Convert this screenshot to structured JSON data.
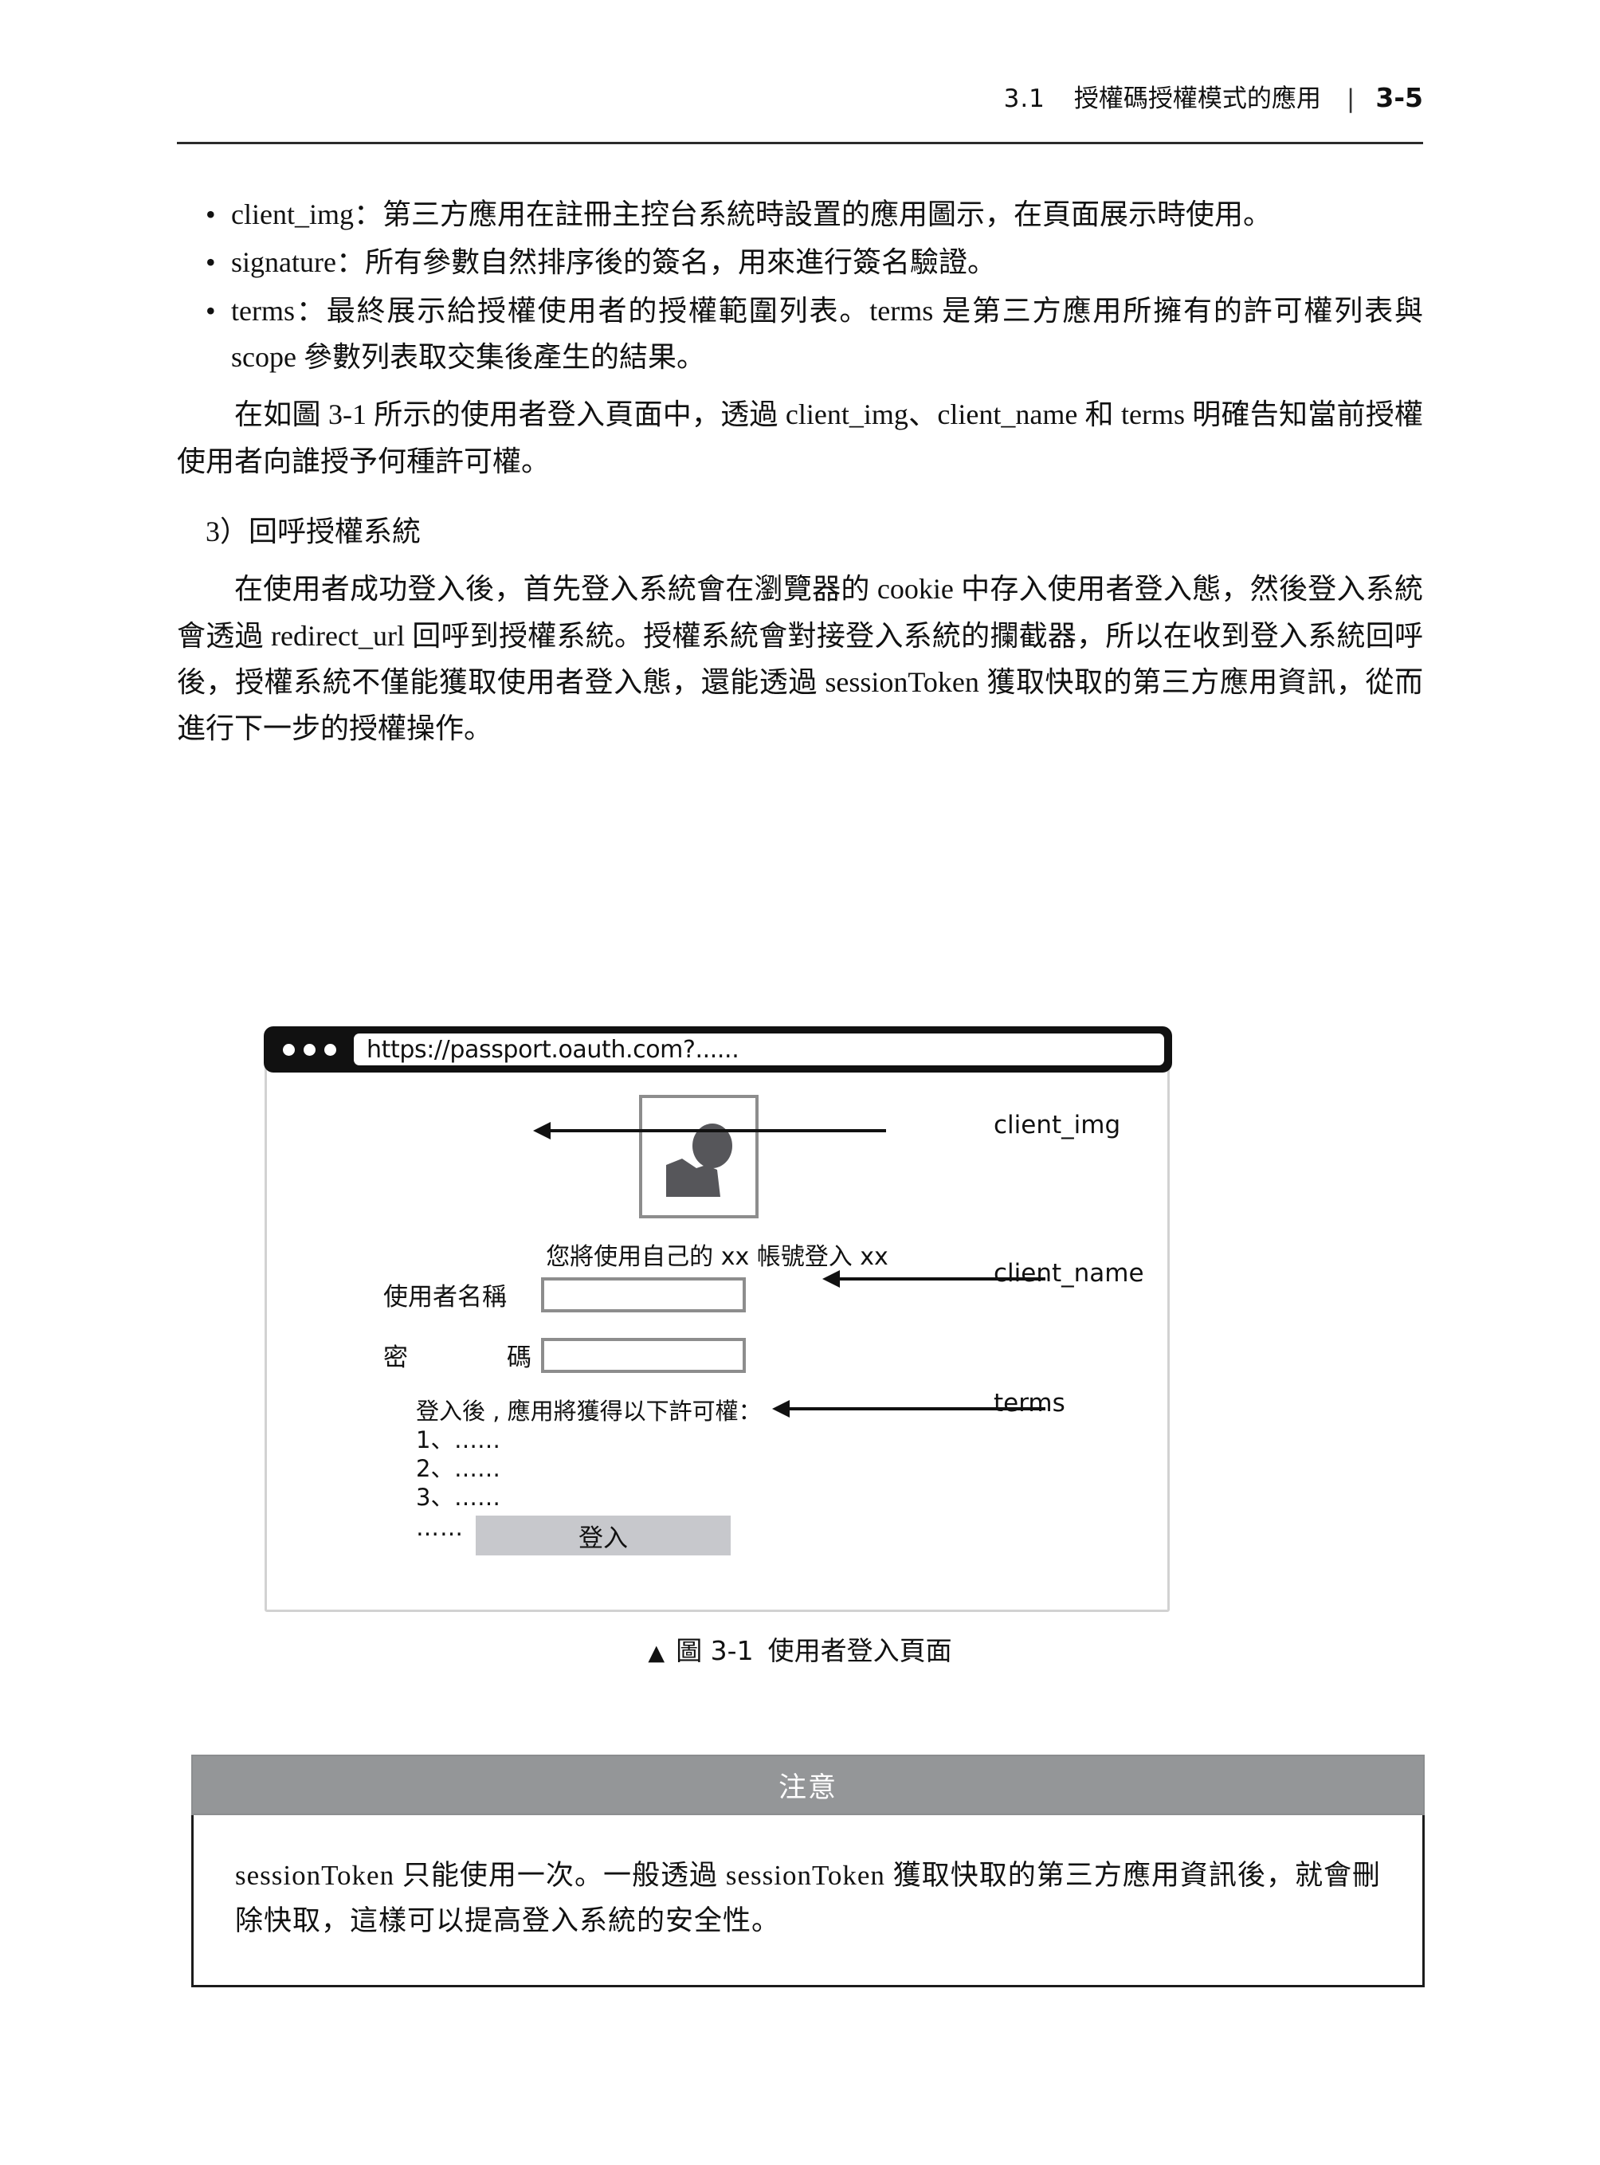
{
  "header": {
    "section_number": "3.1",
    "section_title": "授權碼授權模式的應用",
    "separator": "|",
    "page_number": "3-5"
  },
  "body": {
    "bullets": [
      "client_img：第三方應用在註冊主控台系統時設置的應用圖示，在頁面展示時使用。",
      "signature：所有參數自然排序後的簽名，用來進行簽名驗證。",
      "terms：最終展示給授權使用者的授權範圍列表。terms 是第三方應用所擁有的許可權列表與 scope 參數列表取交集後產生的結果。"
    ],
    "paragraph_1": "在如圖 3-1 所示的使用者登入頁面中，透過 client_img、client_name 和 terms 明確告知當前授權使用者向誰授予何種許可權。",
    "heading_3": "3）回呼授權系統",
    "paragraph_2": "在使用者成功登入後，首先登入系統會在瀏覽器的 cookie 中存入使用者登入態，然後登入系統會透過 redirect_url 回呼到授權系統。授權系統會對接登入系統的攔截器，所以在收到登入系統回呼後，授權系統不僅能獲取使用者登入態，還能透過 sessionToken 獲取快取的第三方應用資訊，從而進行下一步的授權操作。"
  },
  "figure": {
    "browser": {
      "url": "https://passport.oauth.com?......",
      "traffic_dots": 3
    },
    "login_page": {
      "avatar_icon": "person-silhouette-icon",
      "client_message": "您將使用自己的 xx 帳號登入 xx",
      "username_label": "使用者名稱",
      "username_value": "",
      "password_label_left": "密",
      "password_label_right": "碼",
      "password_value": "",
      "terms_title": "登入後 , 應用將獲得以下許可權：",
      "terms_items": [
        {
          "index": "1、",
          "text": "……"
        },
        {
          "index": "2、",
          "text": "……"
        },
        {
          "index": "3、",
          "text": "……"
        }
      ],
      "terms_tail": "……",
      "login_button_label": "登入"
    },
    "annotations": [
      {
        "label": "client_img"
      },
      {
        "label": "client_name"
      },
      {
        "label": "terms"
      }
    ],
    "caption": {
      "marker": "▲",
      "label": "圖 3-1",
      "title": "使用者登入頁面"
    }
  },
  "note": {
    "title": "注意",
    "text": "sessionToken 只能使用一次。一般透過 sessionToken 獲取快取的第三方應用資訊後，就會刪除快取，這樣可以提高登入系統的安全性。"
  },
  "colors": {
    "note_header_bg": "#949698",
    "note_border": "#1c1c1c",
    "browser_bar": "#111111",
    "login_button": "#c7c8cc",
    "field_border": "#8d8d8d",
    "figure_frame": "#d2d2d2",
    "avatar_fill": "#56565a"
  }
}
